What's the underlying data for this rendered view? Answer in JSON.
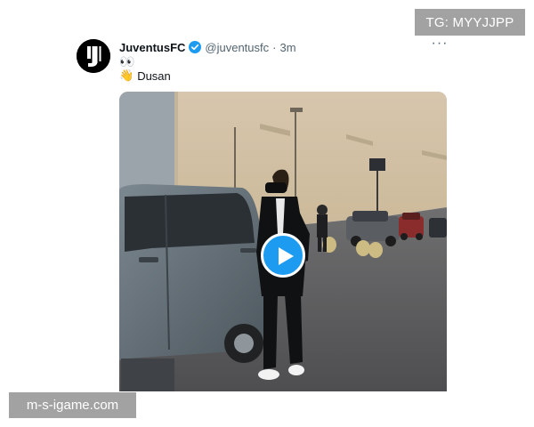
{
  "watermarks": {
    "telegram": "TG: MYYJJPP",
    "site": "m-s-igame.com"
  },
  "tweet": {
    "author_name": "JuventusFC",
    "handle": "@juventusfc",
    "separator": "·",
    "time": "3m",
    "more": "···",
    "text_line1": "👀",
    "text_line2_emoji": "👋",
    "text_line2": "Dusan",
    "verified_color": "#1d9bf0"
  },
  "video": {
    "play_button_color": "#1d9bf0"
  },
  "icons": {
    "avatar": "juventus-logo-icon",
    "verified": "verified-badge-icon",
    "play": "play-icon",
    "more": "more-options-icon"
  }
}
